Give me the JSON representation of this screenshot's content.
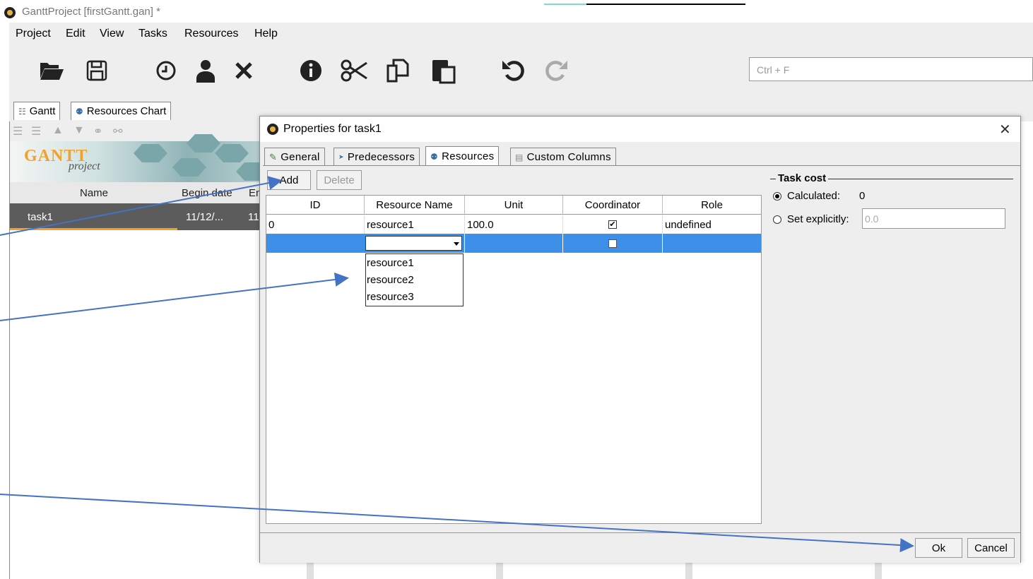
{
  "window": {
    "title": "GanttProject [firstGantt.gan] *"
  },
  "menu": [
    "Project",
    "Edit",
    "View",
    "Tasks",
    "Resources",
    "Help"
  ],
  "toolbar": {
    "search_placeholder": "Ctrl + F",
    "icons": [
      "folder-open-icon",
      "save-icon",
      "clock-icon",
      "person-icon",
      "delete-icon",
      "info-icon",
      "cut-icon",
      "copy-icon",
      "paste-icon",
      "undo-icon",
      "redo-icon"
    ]
  },
  "main_tabs": [
    "Gantt",
    "Resources Chart"
  ],
  "task_table": {
    "columns": [
      "Name",
      "Begin date",
      "En"
    ],
    "rows": [
      {
        "name": "task1",
        "begin": "11/12/...",
        "end": "11"
      }
    ]
  },
  "logo": {
    "text1": "GANTT",
    "text2": "project"
  },
  "dialog": {
    "title": "Properties for task1",
    "tabs": [
      "General",
      "Predecessors",
      "Resources",
      "Custom Columns"
    ],
    "active_tab": "Resources",
    "add_label": "Add",
    "delete_label": "Delete",
    "columns": [
      "ID",
      "Resource Name",
      "Unit",
      "Coordinator",
      "Role"
    ],
    "rows": [
      {
        "id": "0",
        "name": "resource1",
        "unit": "100.0",
        "coordinator": true,
        "role": "undefined"
      }
    ],
    "dropdown_options": [
      "resource1",
      "resource2",
      "resource3"
    ],
    "task_cost": {
      "title": "Task cost",
      "calculated_label": "Calculated:",
      "calculated_value": "0",
      "explicit_label": "Set explicitly:",
      "explicit_placeholder": "0.0"
    },
    "ok_label": "Ok",
    "cancel_label": "Cancel"
  },
  "accent_colors": {
    "selection": "#3d8fe8",
    "task_row": "#5c5c5c",
    "arrow": "#4472c4"
  }
}
